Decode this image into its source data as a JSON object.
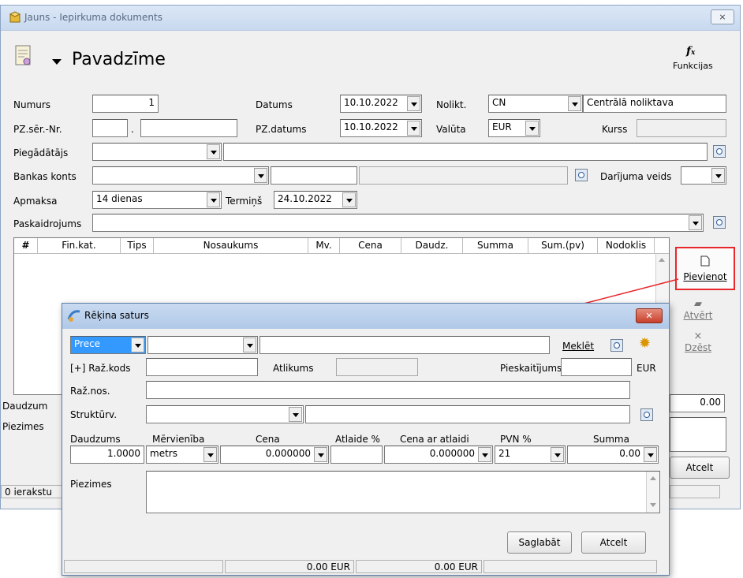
{
  "window": {
    "title": "Jauns - Iepirkuma dokuments",
    "close_label": "⨯"
  },
  "header": {
    "doc_type": "Pavadzīme",
    "functions_icon": "fx-icon",
    "functions_label": "Funkcijas"
  },
  "form": {
    "numurs_label": "Numurs",
    "numurs_value": "1",
    "datums_label": "Datums",
    "datums_value": "10.10.2022",
    "nolikt_label": "Nolikt.",
    "nolikt_code": "CN",
    "nolikt_name": "Centrālā noliktava",
    "pz_ser_label": "PZ.sēr.-Nr.",
    "pz_ser_value": "",
    "pz_nr_value": "",
    "pz_datums_label": "PZ.datums",
    "pz_datums_value": "10.10.2022",
    "valuta_label": "Valūta",
    "valuta_value": "EUR",
    "kurss_label": "Kurss",
    "kurss_value": "",
    "piegadatajs_label": "Piegādātājs",
    "bankas_label": "Bankas konts",
    "darijuma_label": "Darījuma veids",
    "apmaksa_label": "Apmaksa",
    "apmaksa_value": "14 dienas",
    "termins_label": "Termiņš",
    "termins_value": "24.10.2022",
    "paskaidrojums_label": "Paskaidrojums"
  },
  "grid": {
    "columns": [
      "#",
      "Fin.kat.",
      "Tips",
      "Nosaukums",
      "Mv.",
      "Cena",
      "Daudz.",
      "Summa",
      "Sum.(pv)",
      "Nodoklis"
    ]
  },
  "side_buttons": {
    "add": "Pievienot",
    "open": "Atvērt",
    "delete": "Dzēst"
  },
  "bottom": {
    "daudzums_label": "Daudzum",
    "total_value": "0.00",
    "piezimes_label": "Piezimes",
    "cancel_label": "Atcelt",
    "status_text": "0 ierakstu"
  },
  "dialog": {
    "title": "Rēķina saturs",
    "type_value": "Prece",
    "meklet_label": "Meklēt",
    "raz_kods_label": "[+] Raž.kods",
    "atlikums_label": "Atlikums",
    "pieskaitijums_label": "Pieskaitījums",
    "currency": "EUR",
    "raz_nos_label": "Raž.nos.",
    "strukturv_label": "Struktūrv.",
    "col_daudzums": "Daudzums",
    "col_mervieniba": "Mērvienība",
    "col_cena": "Cena",
    "col_atlaide": "Atlaide %",
    "col_cena_atl": "Cena ar atlaidi",
    "col_pvn": "PVN %",
    "col_summa": "Summa",
    "daudzums_value": "1.0000",
    "mervieniba_value": "metrs",
    "cena_value": "0.000000",
    "atlaide_value": "",
    "cena_atl_value": "0.000000",
    "pvn_value": "21",
    "summa_value": "0.00",
    "piezimes_label": "Piezimes",
    "save_label": "Saglabāt",
    "cancel_label": "Atcelt",
    "status_1": "0.00 EUR",
    "status_2": "0.00 EUR"
  },
  "colors": {
    "highlight": "#e8262b",
    "selection": "#3399ff",
    "arrow": "#e8262b"
  }
}
